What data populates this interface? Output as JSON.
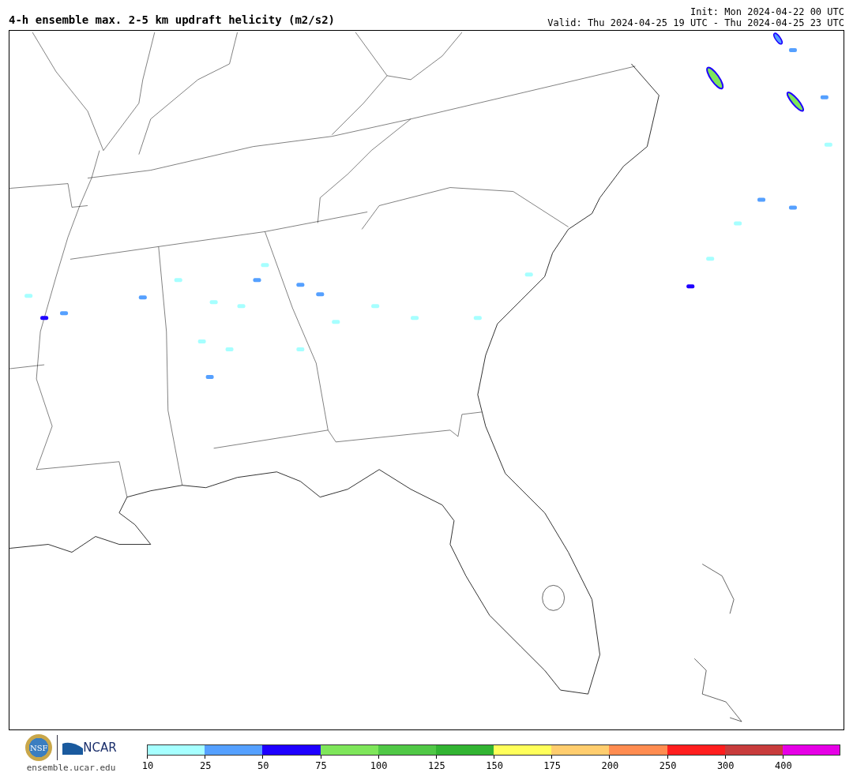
{
  "title": "4-h ensemble max. 2-5 km updraft helicity (m2/s2)",
  "init": "Init: Mon 2024-04-22 00 UTC",
  "valid": "Valid: Thu 2024-04-25 19 UTC - Thu 2024-04-25 23 UTC",
  "logos": {
    "nsf": "NSF",
    "ncar": "NCAR"
  },
  "url": "ensemble.ucar.edu",
  "legend": {
    "bins": [
      {
        "color": "#a6ffff",
        "label": "10"
      },
      {
        "color": "#55a0ff",
        "label": "25"
      },
      {
        "color": "#1e00ff",
        "label": "50"
      },
      {
        "color": "#7ee65a",
        "label": "75"
      },
      {
        "color": "#50c846",
        "label": "100"
      },
      {
        "color": "#32b432",
        "label": "125"
      },
      {
        "color": "#ffff5a",
        "label": "150"
      },
      {
        "color": "#ffcd6e",
        "label": "175"
      },
      {
        "color": "#ff8c50",
        "label": "200"
      },
      {
        "color": "#ff1e1e",
        "label": "250"
      },
      {
        "color": "#c83c3c",
        "label": "300"
      },
      {
        "color": "#e600e6",
        "label": "400"
      }
    ]
  }
}
